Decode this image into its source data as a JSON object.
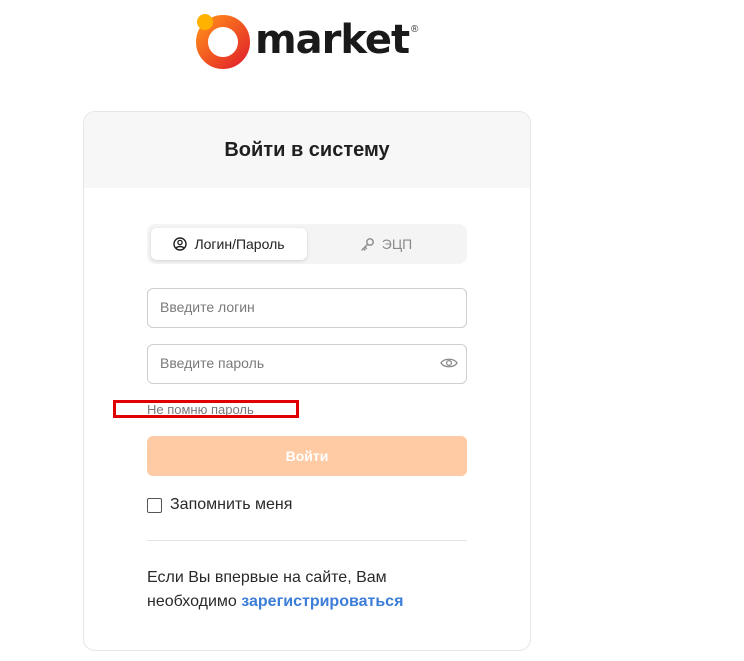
{
  "logo": {
    "text": "market",
    "registered": "®",
    "colors": {
      "primary": "#ff6a1a",
      "accent": "#e3262a",
      "dot": "#ffb300"
    }
  },
  "card": {
    "title": "Войти в систему"
  },
  "tabs": [
    {
      "label": "Логин/Пароль",
      "icon": "user-circle-icon",
      "active": true
    },
    {
      "label": "ЭЦП",
      "icon": "key-icon",
      "active": false
    }
  ],
  "form": {
    "login_placeholder": "Введите логин",
    "password_placeholder": "Введите пароль",
    "forgot_password": "Не помню пароль",
    "submit_label": "Войти",
    "remember_label": "Запомнить меня",
    "remember_checked": false
  },
  "register": {
    "text": "Если Вы впервые на сайте, Вам необходимо",
    "link": "зарегистрироваться"
  },
  "colors": {
    "button_disabled": "#ffcba4",
    "link": "#3b7dd8",
    "highlight": "#e00000"
  }
}
